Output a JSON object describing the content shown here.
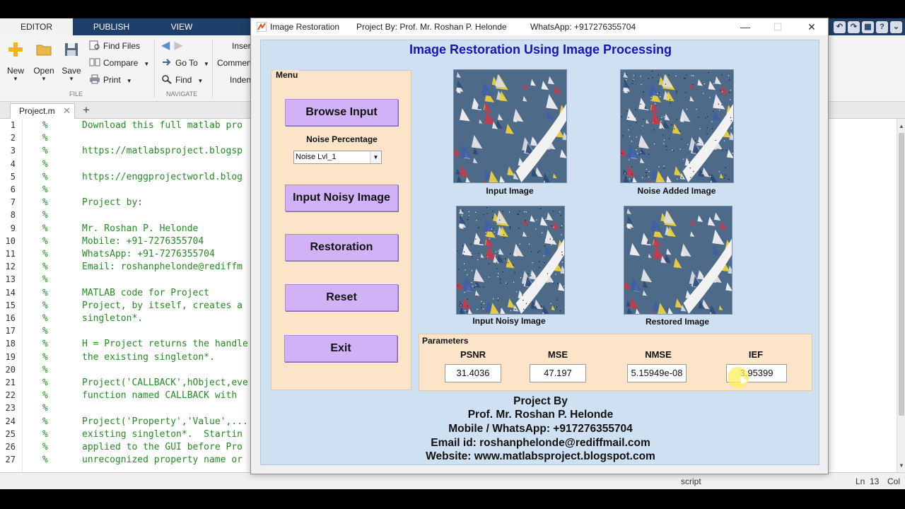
{
  "matlab": {
    "tabs": [
      "EDITOR",
      "PUBLISH",
      "VIEW"
    ],
    "ribbon": {
      "new": "New",
      "open": "Open",
      "save": "Save",
      "find_files": "Find Files",
      "compare": "Compare",
      "print": "Print",
      "go_to": "Go To",
      "find": "Find",
      "insert": "Insert",
      "comment": "Comment",
      "indent": "Indent",
      "group_file": "FILE",
      "group_navigate": "NAVIGATE"
    },
    "file_tab": "Project.m",
    "add_tab": "+",
    "lines": [
      {
        "n": "1",
        "t": "Download this full matlab pro"
      },
      {
        "n": "2",
        "t": ""
      },
      {
        "n": "3",
        "t": "https://matlabsproject.blogsp"
      },
      {
        "n": "4",
        "t": ""
      },
      {
        "n": "5",
        "t": "https://enggprojectworld.blog"
      },
      {
        "n": "6",
        "t": ""
      },
      {
        "n": "7",
        "t": "Project by:"
      },
      {
        "n": "8",
        "t": ""
      },
      {
        "n": "9",
        "t": "Mr. Roshan P. Helonde"
      },
      {
        "n": "10",
        "t": "Mobile: +91-7276355704"
      },
      {
        "n": "11",
        "t": "WhatsApp: +91-7276355704"
      },
      {
        "n": "12",
        "t": "Email: roshanphelonde@rediffm"
      },
      {
        "n": "13",
        "t": ""
      },
      {
        "n": "14",
        "t": "MATLAB code for Project"
      },
      {
        "n": "15",
        "t": "Project, by itself, creates a"
      },
      {
        "n": "16",
        "t": "singleton*."
      },
      {
        "n": "17",
        "t": ""
      },
      {
        "n": "18",
        "t": "H = Project returns the handle"
      },
      {
        "n": "19",
        "t": "the existing singleton*."
      },
      {
        "n": "20",
        "t": ""
      },
      {
        "n": "21",
        "t": "Project('CALLBACK',hObject,eve"
      },
      {
        "n": "22",
        "t": "function named CALLBACK with"
      },
      {
        "n": "23",
        "t": ""
      },
      {
        "n": "24",
        "t": "Project('Property','Value',..."
      },
      {
        "n": "25",
        "t": "existing singleton*.  Startin"
      },
      {
        "n": "26",
        "t": "applied to the GUI before Pro"
      },
      {
        "n": "27",
        "t": "unrecognized property name or"
      }
    ],
    "status": {
      "mode": "script",
      "ln": "Ln",
      "ln_val": "13",
      "col": "Col"
    }
  },
  "figure": {
    "window_title": "Image Restoration",
    "project_by": "Project By: Prof. Mr. Roshan P. Helonde",
    "whatsapp": "WhatsApp: +917276355704",
    "heading": "Image Restoration Using Image Processing",
    "menu": {
      "title": "Menu",
      "browse": "Browse Input",
      "noise_label": "Noise Percentage",
      "noise_selected": "Noise Lvl_1",
      "input_noisy": "Input Noisy Image",
      "restoration": "Restoration",
      "reset": "Reset",
      "exit": "Exit"
    },
    "images": {
      "input": "Input Image",
      "noise_added": "Noise Added Image",
      "input_noisy": "Input Noisy Image",
      "restored": "Restored Image"
    },
    "parameters": {
      "title": "Parameters",
      "psnr_label": "PSNR",
      "psnr": "31.4036",
      "mse_label": "MSE",
      "mse": "47.197",
      "nmse_label": "NMSE",
      "nmse": "5.15949e-08",
      "ief_label": "IEF",
      "ief": "3.95399"
    },
    "credits": {
      "l1": "Project By",
      "l2": "Prof. Mr. Roshan P. Helonde",
      "l3": "Mobile / WhatsApp: +917276355704",
      "l4": "Email id: roshanphelonde@rediffmail.com",
      "l5": "Website: www.matlabsproject.blogspot.com"
    }
  },
  "colors": {
    "toolstrip": "#1f3f6b",
    "figure_bg": "#cfe0f3",
    "panel_bg": "#fbe4c8",
    "button_bg": "#d2b2f7",
    "heading_blue": "#1515b8",
    "comment_green": "#228b22"
  }
}
